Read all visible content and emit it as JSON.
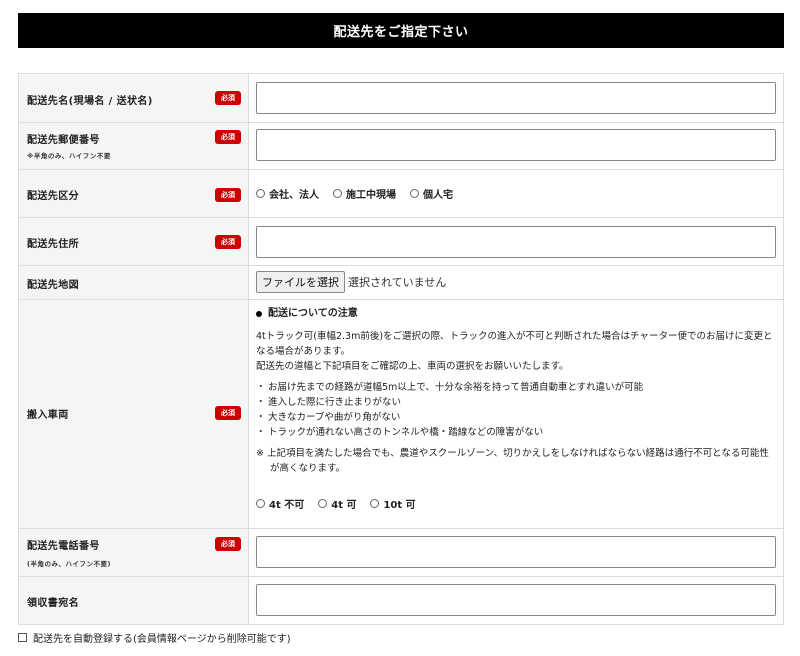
{
  "header": {
    "title": "配送先をご指定下さい"
  },
  "required_label": "必須",
  "fields": {
    "name": {
      "label": "配送先名(現場名 / 送状名)"
    },
    "zip": {
      "label": "配送先郵便番号",
      "sub": "※半角のみ、ハイフン不要"
    },
    "type": {
      "label": "配送先区分",
      "options": [
        "会社、法人",
        "施工中現場",
        "個人宅"
      ]
    },
    "address": {
      "label": "配送先住所"
    },
    "map": {
      "label": "配送先地図",
      "button": "ファイルを選択",
      "status": "選択されていません"
    },
    "vehicle": {
      "label": "搬入車両",
      "notice_title": "配送についての注意",
      "paragraph1": "4tトラック可(車幅2.3m前後)をご選択の際、トラックの進入が不可と判断された場合はチャーター便でのお届けに変更となる場合があります。",
      "paragraph2": "配送先の道幅と下記項目をご確認の上、車両の選択をお願いいたします。",
      "items": [
        "お届け先までの経路が道幅5m以上で、十分な余裕を持って普通自動車とすれ違いが可能",
        "進入した際に行き止まりがない",
        "大きなカーブや曲がり角がない",
        "トラックが通れない高さのトンネルや橋・踏線などの障害がない"
      ],
      "note": "※ 上記項目を満たした場合でも、農道やスクールゾーン、切りかえしをしなければならない経路は通行不可となる可能性が高くなります。",
      "options": [
        "4t 不可",
        "4t 可",
        "10t 可"
      ]
    },
    "phone": {
      "label": "配送先電話番号",
      "sub": "(半角のみ、ハイフン不要)"
    },
    "receipt": {
      "label": "領収書宛名"
    }
  },
  "auto_register": {
    "label": "配送先を自動登録する(会員情報ページから削除可能です)"
  }
}
